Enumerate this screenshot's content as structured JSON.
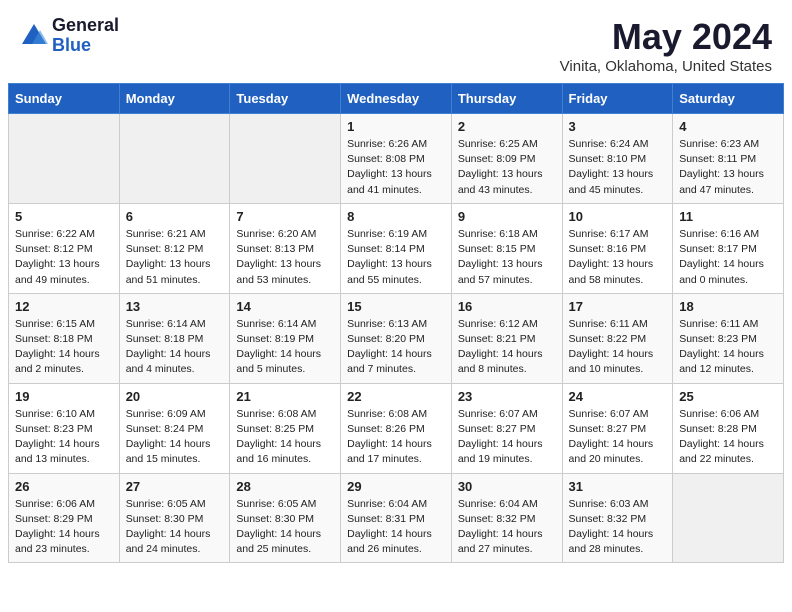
{
  "header": {
    "logo_general": "General",
    "logo_blue": "Blue",
    "title": "May 2024",
    "subtitle": "Vinita, Oklahoma, United States"
  },
  "days_of_week": [
    "Sunday",
    "Monday",
    "Tuesday",
    "Wednesday",
    "Thursday",
    "Friday",
    "Saturday"
  ],
  "weeks": [
    [
      {
        "num": "",
        "sunrise": "",
        "sunset": "",
        "daylight": "",
        "empty": true
      },
      {
        "num": "",
        "sunrise": "",
        "sunset": "",
        "daylight": "",
        "empty": true
      },
      {
        "num": "",
        "sunrise": "",
        "sunset": "",
        "daylight": "",
        "empty": true
      },
      {
        "num": "1",
        "sunrise": "Sunrise: 6:26 AM",
        "sunset": "Sunset: 8:08 PM",
        "daylight": "Daylight: 13 hours and 41 minutes."
      },
      {
        "num": "2",
        "sunrise": "Sunrise: 6:25 AM",
        "sunset": "Sunset: 8:09 PM",
        "daylight": "Daylight: 13 hours and 43 minutes."
      },
      {
        "num": "3",
        "sunrise": "Sunrise: 6:24 AM",
        "sunset": "Sunset: 8:10 PM",
        "daylight": "Daylight: 13 hours and 45 minutes."
      },
      {
        "num": "4",
        "sunrise": "Sunrise: 6:23 AM",
        "sunset": "Sunset: 8:11 PM",
        "daylight": "Daylight: 13 hours and 47 minutes."
      }
    ],
    [
      {
        "num": "5",
        "sunrise": "Sunrise: 6:22 AM",
        "sunset": "Sunset: 8:12 PM",
        "daylight": "Daylight: 13 hours and 49 minutes."
      },
      {
        "num": "6",
        "sunrise": "Sunrise: 6:21 AM",
        "sunset": "Sunset: 8:12 PM",
        "daylight": "Daylight: 13 hours and 51 minutes."
      },
      {
        "num": "7",
        "sunrise": "Sunrise: 6:20 AM",
        "sunset": "Sunset: 8:13 PM",
        "daylight": "Daylight: 13 hours and 53 minutes."
      },
      {
        "num": "8",
        "sunrise": "Sunrise: 6:19 AM",
        "sunset": "Sunset: 8:14 PM",
        "daylight": "Daylight: 13 hours and 55 minutes."
      },
      {
        "num": "9",
        "sunrise": "Sunrise: 6:18 AM",
        "sunset": "Sunset: 8:15 PM",
        "daylight": "Daylight: 13 hours and 57 minutes."
      },
      {
        "num": "10",
        "sunrise": "Sunrise: 6:17 AM",
        "sunset": "Sunset: 8:16 PM",
        "daylight": "Daylight: 13 hours and 58 minutes."
      },
      {
        "num": "11",
        "sunrise": "Sunrise: 6:16 AM",
        "sunset": "Sunset: 8:17 PM",
        "daylight": "Daylight: 14 hours and 0 minutes."
      }
    ],
    [
      {
        "num": "12",
        "sunrise": "Sunrise: 6:15 AM",
        "sunset": "Sunset: 8:18 PM",
        "daylight": "Daylight: 14 hours and 2 minutes."
      },
      {
        "num": "13",
        "sunrise": "Sunrise: 6:14 AM",
        "sunset": "Sunset: 8:18 PM",
        "daylight": "Daylight: 14 hours and 4 minutes."
      },
      {
        "num": "14",
        "sunrise": "Sunrise: 6:14 AM",
        "sunset": "Sunset: 8:19 PM",
        "daylight": "Daylight: 14 hours and 5 minutes."
      },
      {
        "num": "15",
        "sunrise": "Sunrise: 6:13 AM",
        "sunset": "Sunset: 8:20 PM",
        "daylight": "Daylight: 14 hours and 7 minutes."
      },
      {
        "num": "16",
        "sunrise": "Sunrise: 6:12 AM",
        "sunset": "Sunset: 8:21 PM",
        "daylight": "Daylight: 14 hours and 8 minutes."
      },
      {
        "num": "17",
        "sunrise": "Sunrise: 6:11 AM",
        "sunset": "Sunset: 8:22 PM",
        "daylight": "Daylight: 14 hours and 10 minutes."
      },
      {
        "num": "18",
        "sunrise": "Sunrise: 6:11 AM",
        "sunset": "Sunset: 8:23 PM",
        "daylight": "Daylight: 14 hours and 12 minutes."
      }
    ],
    [
      {
        "num": "19",
        "sunrise": "Sunrise: 6:10 AM",
        "sunset": "Sunset: 8:23 PM",
        "daylight": "Daylight: 14 hours and 13 minutes."
      },
      {
        "num": "20",
        "sunrise": "Sunrise: 6:09 AM",
        "sunset": "Sunset: 8:24 PM",
        "daylight": "Daylight: 14 hours and 15 minutes."
      },
      {
        "num": "21",
        "sunrise": "Sunrise: 6:08 AM",
        "sunset": "Sunset: 8:25 PM",
        "daylight": "Daylight: 14 hours and 16 minutes."
      },
      {
        "num": "22",
        "sunrise": "Sunrise: 6:08 AM",
        "sunset": "Sunset: 8:26 PM",
        "daylight": "Daylight: 14 hours and 17 minutes."
      },
      {
        "num": "23",
        "sunrise": "Sunrise: 6:07 AM",
        "sunset": "Sunset: 8:27 PM",
        "daylight": "Daylight: 14 hours and 19 minutes."
      },
      {
        "num": "24",
        "sunrise": "Sunrise: 6:07 AM",
        "sunset": "Sunset: 8:27 PM",
        "daylight": "Daylight: 14 hours and 20 minutes."
      },
      {
        "num": "25",
        "sunrise": "Sunrise: 6:06 AM",
        "sunset": "Sunset: 8:28 PM",
        "daylight": "Daylight: 14 hours and 22 minutes."
      }
    ],
    [
      {
        "num": "26",
        "sunrise": "Sunrise: 6:06 AM",
        "sunset": "Sunset: 8:29 PM",
        "daylight": "Daylight: 14 hours and 23 minutes."
      },
      {
        "num": "27",
        "sunrise": "Sunrise: 6:05 AM",
        "sunset": "Sunset: 8:30 PM",
        "daylight": "Daylight: 14 hours and 24 minutes."
      },
      {
        "num": "28",
        "sunrise": "Sunrise: 6:05 AM",
        "sunset": "Sunset: 8:30 PM",
        "daylight": "Daylight: 14 hours and 25 minutes."
      },
      {
        "num": "29",
        "sunrise": "Sunrise: 6:04 AM",
        "sunset": "Sunset: 8:31 PM",
        "daylight": "Daylight: 14 hours and 26 minutes."
      },
      {
        "num": "30",
        "sunrise": "Sunrise: 6:04 AM",
        "sunset": "Sunset: 8:32 PM",
        "daylight": "Daylight: 14 hours and 27 minutes."
      },
      {
        "num": "31",
        "sunrise": "Sunrise: 6:03 AM",
        "sunset": "Sunset: 8:32 PM",
        "daylight": "Daylight: 14 hours and 28 minutes."
      },
      {
        "num": "",
        "sunrise": "",
        "sunset": "",
        "daylight": "",
        "empty": true
      }
    ]
  ]
}
